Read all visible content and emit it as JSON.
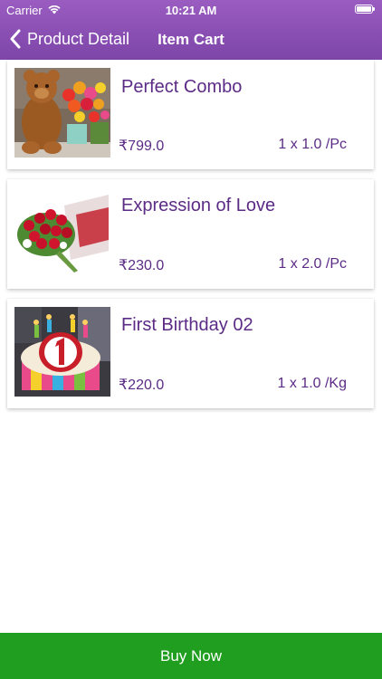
{
  "status_bar": {
    "carrier": "Carrier",
    "time": "10:21 AM"
  },
  "nav": {
    "back_label": "Product Detail",
    "title": "Item Cart"
  },
  "cart": {
    "items": [
      {
        "name": "Perfect Combo",
        "price": "₹799.0",
        "qty": "1 x 1.0 /Pc",
        "image": "teddy-bear-with-flowers"
      },
      {
        "name": "Expression of Love",
        "price": "₹230.0",
        "qty": "1 x 2.0 /Pc",
        "image": "red-rose-bouquet"
      },
      {
        "name": "First Birthday 02",
        "price": "₹220.0",
        "qty": "1 x 1.0 /Kg",
        "image": "birthday-cake-number-one"
      }
    ]
  },
  "buy_button": {
    "label": "Buy Now"
  },
  "colors": {
    "nav_gradient_top": "#9a5cc0",
    "nav_gradient_bottom": "#7e46a8",
    "text_purple": "#5b2b86",
    "buy_green": "#1f9e1f"
  }
}
